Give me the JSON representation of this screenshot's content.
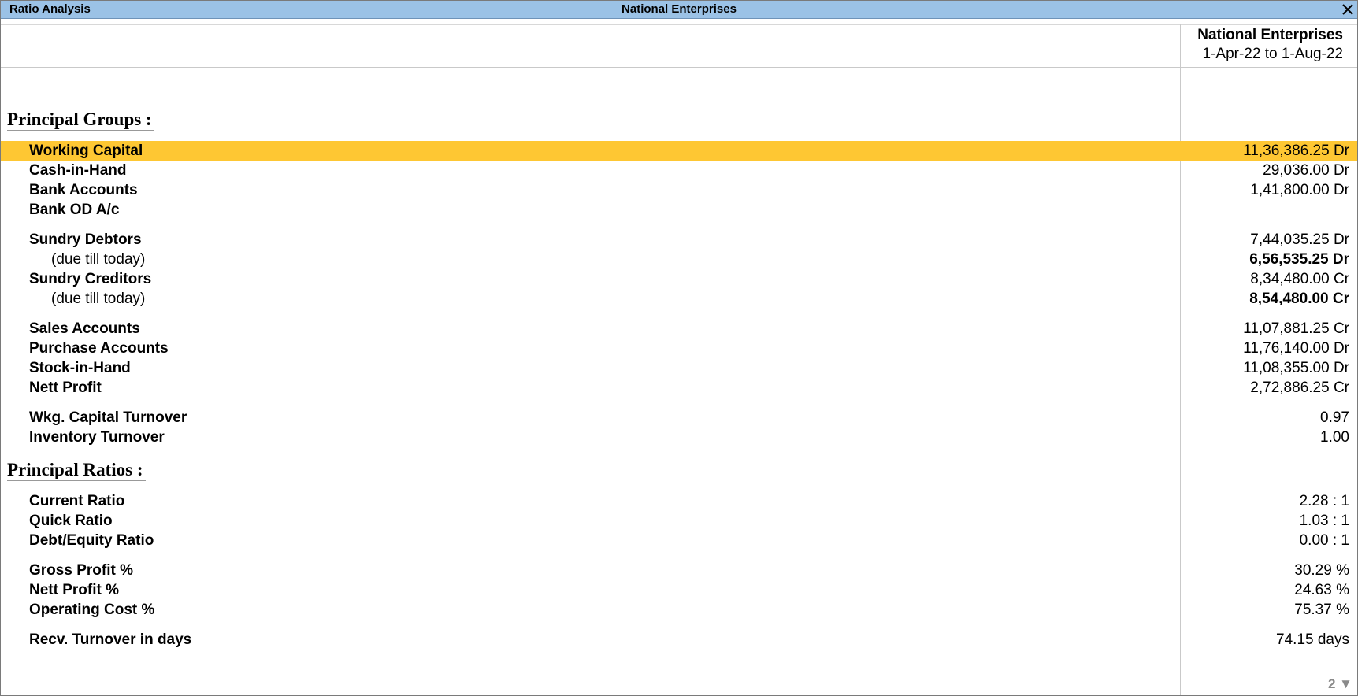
{
  "titlebar": {
    "left": "Ratio Analysis",
    "center": "National Enterprises"
  },
  "column_header": {
    "company": "National Enterprises",
    "period": "1-Apr-22 to 1-Aug-22"
  },
  "sections": {
    "groups_title": "Principal Groups :",
    "ratios_title": "Principal Ratios :"
  },
  "groups": [
    {
      "label": "Working Capital",
      "value": "11,36,386.25 Dr"
    },
    {
      "label": "Cash-in-Hand",
      "value": "29,036.00 Dr"
    },
    {
      "label": "Bank Accounts",
      "value": "1,41,800.00 Dr"
    },
    {
      "label": "Bank OD A/c",
      "value": ""
    },
    {
      "label": "Sundry Debtors",
      "value": "7,44,035.25 Dr"
    },
    {
      "label": "(due till today)",
      "value": "6,56,535.25 Dr"
    },
    {
      "label": "Sundry Creditors",
      "value": "8,34,480.00 Cr"
    },
    {
      "label": "(due till today)",
      "value": "8,54,480.00 Cr"
    },
    {
      "label": "Sales Accounts",
      "value": "11,07,881.25 Cr"
    },
    {
      "label": "Purchase Accounts",
      "value": "11,76,140.00 Dr"
    },
    {
      "label": "Stock-in-Hand",
      "value": "11,08,355.00 Dr"
    },
    {
      "label": "Nett Profit",
      "value": "2,72,886.25 Cr"
    },
    {
      "label": "Wkg. Capital Turnover",
      "value": "0.97"
    },
    {
      "label": "Inventory Turnover",
      "value": "1.00"
    }
  ],
  "ratios": [
    {
      "label": "Current Ratio",
      "value": "2.28 : 1"
    },
    {
      "label": "Quick Ratio",
      "value": "1.03 : 1"
    },
    {
      "label": "Debt/Equity Ratio",
      "value": "0.00 : 1"
    },
    {
      "label": "Gross Profit %",
      "value": "30.29 %"
    },
    {
      "label": "Nett Profit %",
      "value": "24.63 %"
    },
    {
      "label": "Operating Cost %",
      "value": "75.37 %"
    },
    {
      "label": "Recv. Turnover in days",
      "value": "74.15 days"
    }
  ],
  "page_indicator": "2 ▼",
  "colors": {
    "titlebar": "#9bc2e6",
    "selected_row": "#fec733"
  },
  "icons": {
    "close": "close-icon"
  }
}
